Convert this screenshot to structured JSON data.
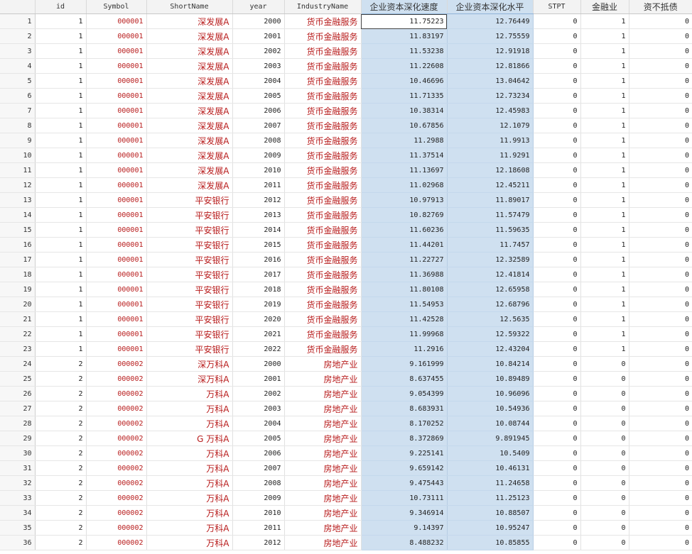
{
  "columns": [
    "id",
    "Symbol",
    "ShortName",
    "year",
    "IndustryName",
    "企业资本深化速度",
    "企业资本深化水平",
    "STPT",
    "金融业",
    "资不抵债"
  ],
  "rows": [
    [
      "1",
      "000001",
      "深发展A",
      "2000",
      "货币金融服务",
      "11.75223",
      "12.76449",
      "0",
      "1",
      "0"
    ],
    [
      "1",
      "000001",
      "深发展A",
      "2001",
      "货币金融服务",
      "11.83197",
      "12.75559",
      "0",
      "1",
      "0"
    ],
    [
      "1",
      "000001",
      "深发展A",
      "2002",
      "货币金融服务",
      "11.53238",
      "12.91918",
      "0",
      "1",
      "0"
    ],
    [
      "1",
      "000001",
      "深发展A",
      "2003",
      "货币金融服务",
      "11.22608",
      "12.81866",
      "0",
      "1",
      "0"
    ],
    [
      "1",
      "000001",
      "深发展A",
      "2004",
      "货币金融服务",
      "10.46696",
      "13.04642",
      "0",
      "1",
      "0"
    ],
    [
      "1",
      "000001",
      "深发展A",
      "2005",
      "货币金融服务",
      "11.71335",
      "12.73234",
      "0",
      "1",
      "0"
    ],
    [
      "1",
      "000001",
      "深发展A",
      "2006",
      "货币金融服务",
      "10.38314",
      "12.45983",
      "0",
      "1",
      "0"
    ],
    [
      "1",
      "000001",
      "深发展A",
      "2007",
      "货币金融服务",
      "10.67856",
      "12.1079",
      "0",
      "1",
      "0"
    ],
    [
      "1",
      "000001",
      "深发展A",
      "2008",
      "货币金融服务",
      "11.2988",
      "11.9913",
      "0",
      "1",
      "0"
    ],
    [
      "1",
      "000001",
      "深发展A",
      "2009",
      "货币金融服务",
      "11.37514",
      "11.9291",
      "0",
      "1",
      "0"
    ],
    [
      "1",
      "000001",
      "深发展A",
      "2010",
      "货币金融服务",
      "11.13697",
      "12.18608",
      "0",
      "1",
      "0"
    ],
    [
      "1",
      "000001",
      "深发展A",
      "2011",
      "货币金融服务",
      "11.02968",
      "12.45211",
      "0",
      "1",
      "0"
    ],
    [
      "1",
      "000001",
      "平安银行",
      "2012",
      "货币金融服务",
      "10.97913",
      "11.89017",
      "0",
      "1",
      "0"
    ],
    [
      "1",
      "000001",
      "平安银行",
      "2013",
      "货币金融服务",
      "10.82769",
      "11.57479",
      "0",
      "1",
      "0"
    ],
    [
      "1",
      "000001",
      "平安银行",
      "2014",
      "货币金融服务",
      "11.60236",
      "11.59635",
      "0",
      "1",
      "0"
    ],
    [
      "1",
      "000001",
      "平安银行",
      "2015",
      "货币金融服务",
      "11.44201",
      "11.7457",
      "0",
      "1",
      "0"
    ],
    [
      "1",
      "000001",
      "平安银行",
      "2016",
      "货币金融服务",
      "11.22727",
      "12.32589",
      "0",
      "1",
      "0"
    ],
    [
      "1",
      "000001",
      "平安银行",
      "2017",
      "货币金融服务",
      "11.36988",
      "12.41814",
      "0",
      "1",
      "0"
    ],
    [
      "1",
      "000001",
      "平安银行",
      "2018",
      "货币金融服务",
      "11.80108",
      "12.65958",
      "0",
      "1",
      "0"
    ],
    [
      "1",
      "000001",
      "平安银行",
      "2019",
      "货币金融服务",
      "11.54953",
      "12.68796",
      "0",
      "1",
      "0"
    ],
    [
      "1",
      "000001",
      "平安银行",
      "2020",
      "货币金融服务",
      "11.42528",
      "12.5635",
      "0",
      "1",
      "0"
    ],
    [
      "1",
      "000001",
      "平安银行",
      "2021",
      "货币金融服务",
      "11.99968",
      "12.59322",
      "0",
      "1",
      "0"
    ],
    [
      "1",
      "000001",
      "平安银行",
      "2022",
      "货币金融服务",
      "11.2916",
      "12.43204",
      "0",
      "1",
      "0"
    ],
    [
      "2",
      "000002",
      "深万科A",
      "2000",
      "房地产业",
      "9.161999",
      "10.84214",
      "0",
      "0",
      "0"
    ],
    [
      "2",
      "000002",
      "深万科A",
      "2001",
      "房地产业",
      "8.637455",
      "10.89489",
      "0",
      "0",
      "0"
    ],
    [
      "2",
      "000002",
      "万科A",
      "2002",
      "房地产业",
      "9.054399",
      "10.96096",
      "0",
      "0",
      "0"
    ],
    [
      "2",
      "000002",
      "万科A",
      "2003",
      "房地产业",
      "8.683931",
      "10.54936",
      "0",
      "0",
      "0"
    ],
    [
      "2",
      "000002",
      "万科A",
      "2004",
      "房地产业",
      "8.170252",
      "10.08744",
      "0",
      "0",
      "0"
    ],
    [
      "2",
      "000002",
      "G 万科A",
      "2005",
      "房地产业",
      "8.372869",
      "9.891945",
      "0",
      "0",
      "0"
    ],
    [
      "2",
      "000002",
      "万科A",
      "2006",
      "房地产业",
      "9.225141",
      "10.5409",
      "0",
      "0",
      "0"
    ],
    [
      "2",
      "000002",
      "万科A",
      "2007",
      "房地产业",
      "9.659142",
      "10.46131",
      "0",
      "0",
      "0"
    ],
    [
      "2",
      "000002",
      "万科A",
      "2008",
      "房地产业",
      "9.475443",
      "11.24658",
      "0",
      "0",
      "0"
    ],
    [
      "2",
      "000002",
      "万科A",
      "2009",
      "房地产业",
      "10.73111",
      "11.25123",
      "0",
      "0",
      "0"
    ],
    [
      "2",
      "000002",
      "万科A",
      "2010",
      "房地产业",
      "9.346914",
      "10.88507",
      "0",
      "0",
      "0"
    ],
    [
      "2",
      "000002",
      "万科A",
      "2011",
      "房地产业",
      "9.14397",
      "10.95247",
      "0",
      "0",
      "0"
    ],
    [
      "2",
      "000002",
      "万科A",
      "2012",
      "房地产业",
      "8.488232",
      "10.85855",
      "0",
      "0",
      "0"
    ]
  ],
  "colors": {
    "string_text": "#b81c1c",
    "selection": "#cfe0f0"
  }
}
